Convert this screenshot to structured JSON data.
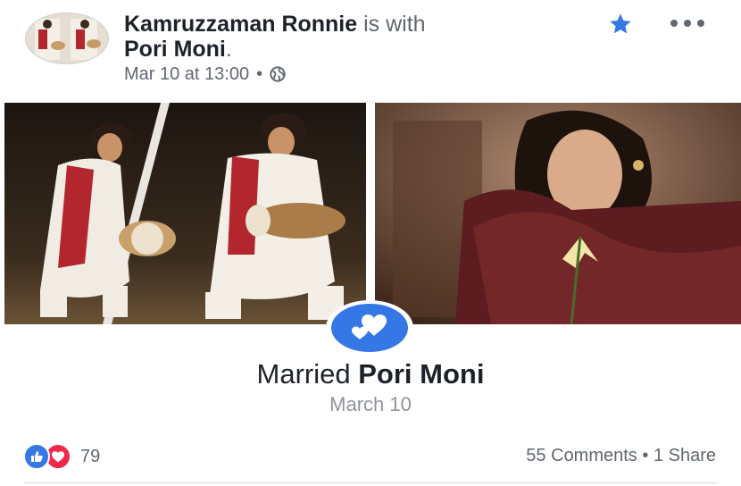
{
  "post": {
    "author": "Kamruzzaman Ronnie",
    "with_text": "is with",
    "tagged_person": "Pori Moni",
    "tagged_suffix": ".",
    "timestamp": "Mar 10 at 13:00",
    "separator": "•",
    "privacy_icon": "globe-icon",
    "star_icon": "star-icon",
    "more_icon": "more-options-icon"
  },
  "life_event": {
    "icon": "hearts-icon",
    "title_prefix": "Married",
    "title_person": "Pori Moni",
    "date": "March 10"
  },
  "footer": {
    "reactions": [
      "like",
      "love"
    ],
    "reaction_count": "79",
    "comments": "55 Comments",
    "separator": "•",
    "shares": "1 Share"
  },
  "colors": {
    "accent_blue": "#3578e5",
    "love_red": "#f0284a",
    "meta_gray": "#616770"
  }
}
